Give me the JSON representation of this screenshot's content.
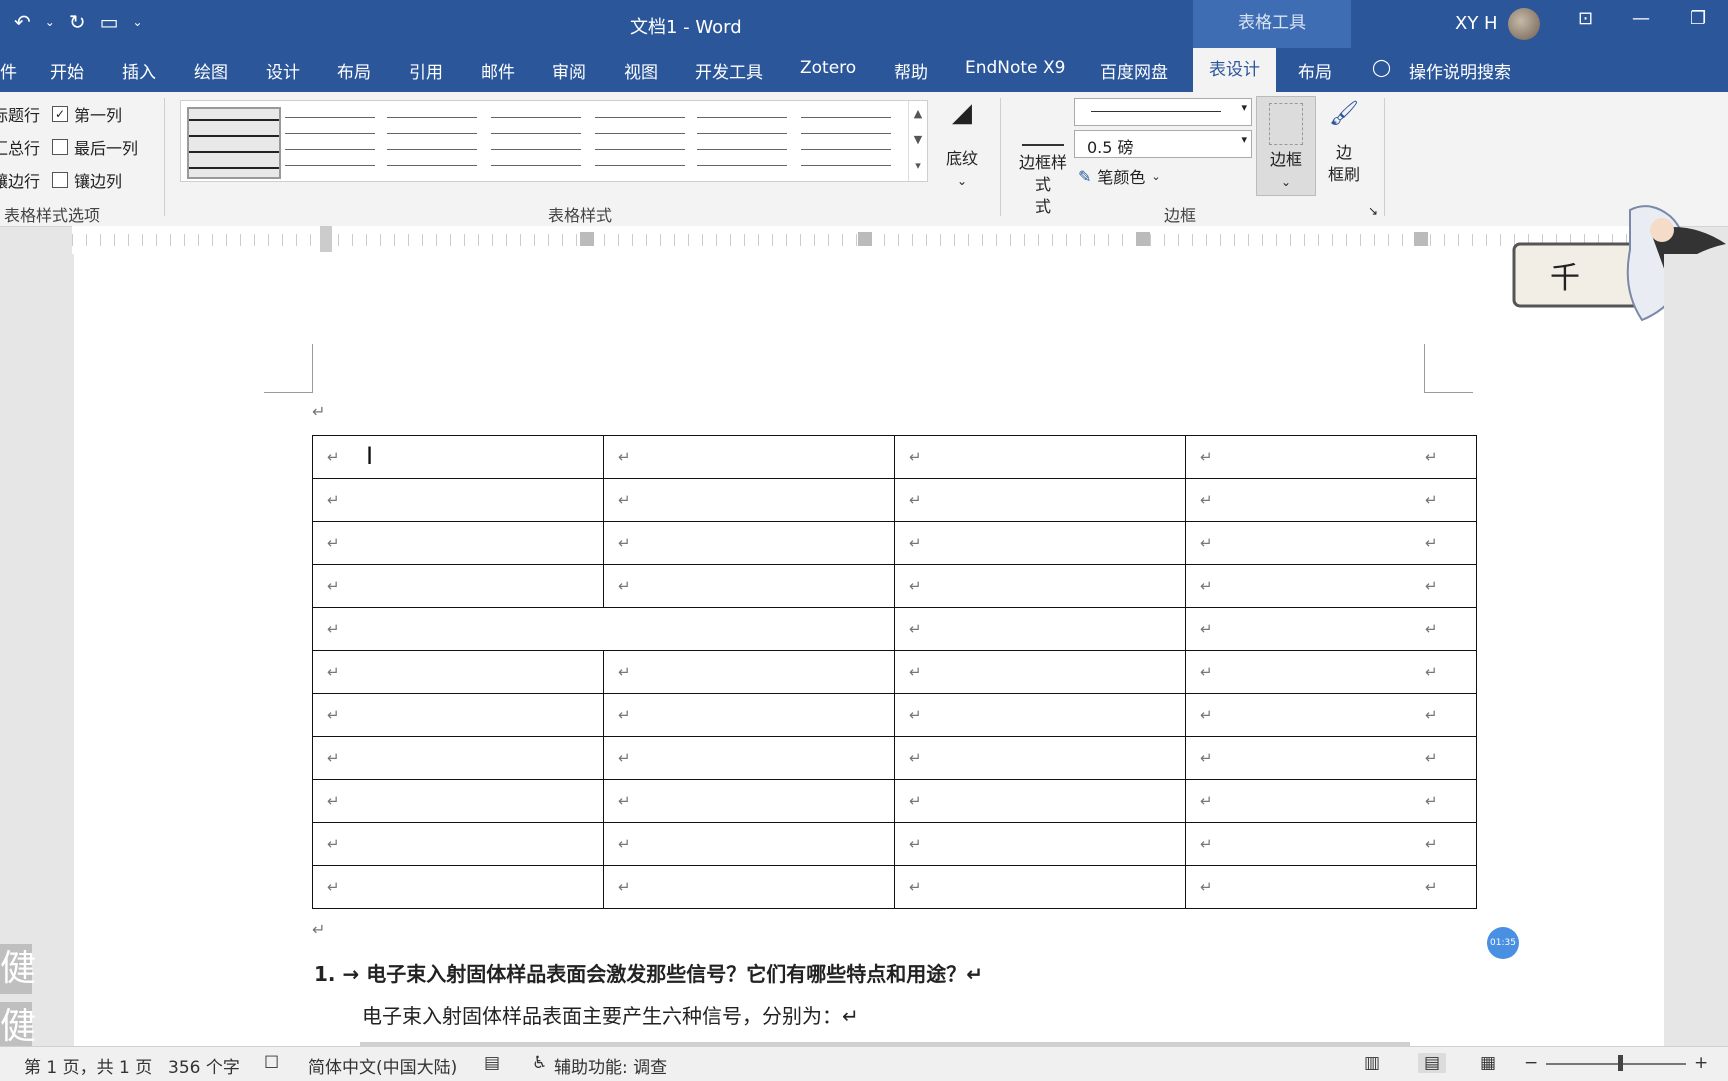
{
  "titlebar": {
    "doc_title": "文档1  -  Word",
    "context_tools": "表格工具",
    "user": "XY H",
    "qat": {
      "undo": "↶",
      "undo_dd": "⌄",
      "redo": "↻",
      "open": "▭",
      "more": "⌄"
    },
    "win": {
      "ribbon_opts": "⊡",
      "minimize": "—",
      "restore": "❐"
    }
  },
  "tabs": [
    "开始",
    "插入",
    "绘图",
    "设计",
    "布局",
    "引用",
    "邮件",
    "审阅",
    "视图",
    "开发工具",
    "Zotero",
    "帮助",
    "EndNote X9",
    "百度网盘"
  ],
  "tabs_partial": "件",
  "active_tab": "表设计",
  "layout_tab": "布局",
  "tell_me": "操作说明搜索",
  "ribbon": {
    "options": [
      {
        "label": "标题行",
        "shown": "标题行",
        "checked": true
      },
      {
        "label": "汇总行",
        "shown": "汇总行",
        "checked": false
      },
      {
        "label": "镶边行",
        "shown": "镶边行",
        "checked": true
      },
      {
        "label": "第一列",
        "checked": true
      },
      {
        "label": "最后一列",
        "checked": false
      },
      {
        "label": "镶边列",
        "checked": false
      }
    ],
    "options_group": "表格样式选项",
    "styles_group": "表格样式",
    "shading": "底纹",
    "border_style": "边框样式",
    "border_style_l2": "式",
    "weight": "0.5 磅",
    "pen_color": "笔颜色",
    "borders": "边框",
    "border_painter_l1": "边",
    "border_painter_l2": "框刷",
    "border_group": "边框"
  },
  "table": {
    "rows": 11,
    "cols": 4,
    "merged_row_index": 4,
    "merged_span": 2,
    "mark": "↵"
  },
  "document": {
    "heading": "1. → 电子束入射固体样品表面会激发那些信号？它们有哪些特点和用途？↵",
    "body": "电子束入射固体样品表面主要产生六种信号，分别为：↵"
  },
  "timer": "01:35",
  "ime_char": "健",
  "status": {
    "page": "第 1 页，共 1 页",
    "words": "356 个字",
    "lang": "简体中文(中国大陆)",
    "access": "辅助功能: 调查",
    "zoom_minus": "−",
    "zoom_plus": "+"
  }
}
